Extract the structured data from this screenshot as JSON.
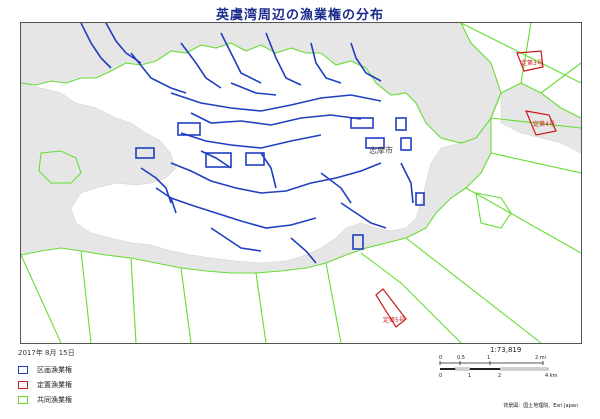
{
  "title": "英虞湾周辺の漁業権の分布",
  "date": "2017年 8月 15日",
  "city_label": "志摩市",
  "legend": {
    "items": [
      {
        "label": "区画漁業権",
        "color": "#1f3fbf"
      },
      {
        "label": "定置漁業権",
        "color": "#cc1a1a"
      },
      {
        "label": "共同漁業権",
        "color": "#66dd33"
      }
    ]
  },
  "fixed_net_labels": [
    "定第3号",
    "定第4号",
    "定第5号"
  ],
  "scale": {
    "ratio": "1:73,819",
    "miles_ticks": [
      "0",
      "0.5",
      "1",
      "2 mi"
    ],
    "km_ticks": [
      "0",
      "1",
      "2",
      "4 km"
    ]
  },
  "credit": "背景図：国土地理院、Esri Japan",
  "colors": {
    "zone_blue": "#1f3fbf",
    "fixed_red": "#cc1a1a",
    "common_green": "#66dd33",
    "land": "#e8e8e8",
    "sea": "#ffffff"
  }
}
